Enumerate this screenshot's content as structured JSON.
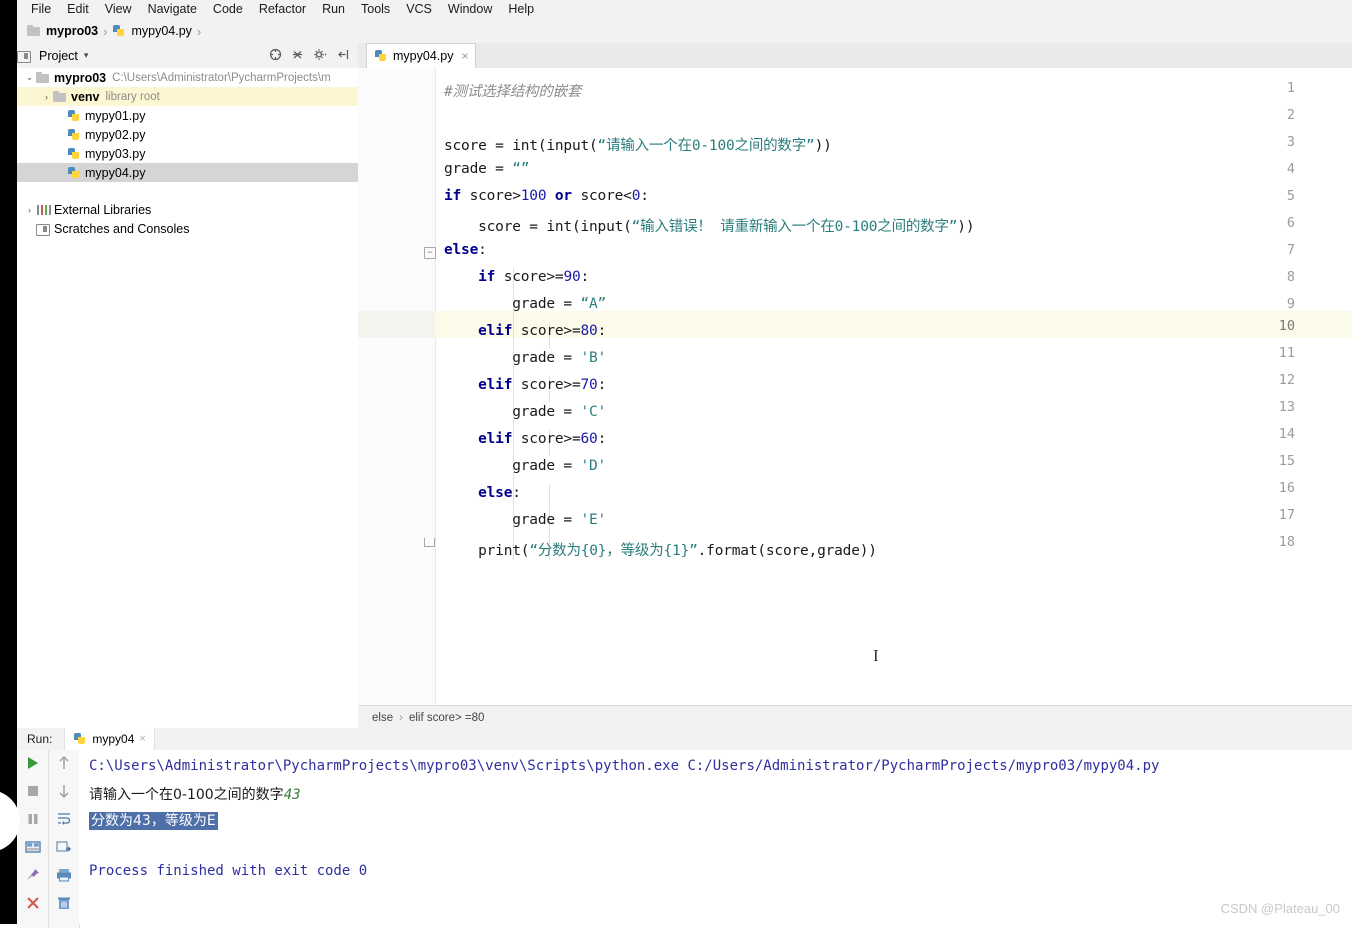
{
  "menu": {
    "items": [
      "File",
      "Edit",
      "View",
      "Navigate",
      "Code",
      "Refactor",
      "Run",
      "Tools",
      "VCS",
      "Window",
      "Help"
    ]
  },
  "navbar": {
    "project_name": "mypro03",
    "file_name": "mypy04.py",
    "separator": "›"
  },
  "project_panel": {
    "title": "Project",
    "caret": "▾",
    "tools": [
      "target-icon",
      "collapse-all-icon",
      "settings-icon",
      "hide-icon"
    ],
    "tree": [
      {
        "label": "mypro03",
        "path": "C:\\Users\\Administrator\\PycharmProjects\\m",
        "icon": "folder-icon",
        "arrow": "⌄",
        "depth": 0,
        "bold": true,
        "state": "normal"
      },
      {
        "label": "venv",
        "path": "library root",
        "icon": "folder-icon",
        "arrow": "›",
        "depth": 1,
        "bold": true,
        "state": "yellow"
      },
      {
        "label": "mypy01.py",
        "path": "",
        "icon": "python-file-icon",
        "arrow": "",
        "depth": 2,
        "bold": false,
        "state": "normal"
      },
      {
        "label": "mypy02.py",
        "path": "",
        "icon": "python-file-icon",
        "arrow": "",
        "depth": 2,
        "bold": false,
        "state": "normal"
      },
      {
        "label": "mypy03.py",
        "path": "",
        "icon": "python-file-icon",
        "arrow": "",
        "depth": 2,
        "bold": false,
        "state": "normal"
      },
      {
        "label": "mypy04.py",
        "path": "",
        "icon": "python-file-icon",
        "arrow": "",
        "depth": 2,
        "bold": false,
        "state": "gray"
      },
      {
        "label": "External Libraries",
        "path": "",
        "icon": "libraries-icon",
        "arrow": "›",
        "depth": 0,
        "bold": false,
        "state": "normal"
      },
      {
        "label": "Scratches and Consoles",
        "path": "",
        "icon": "scratches-icon",
        "arrow": "",
        "depth": 0,
        "bold": false,
        "state": "normal"
      }
    ]
  },
  "editor": {
    "tab_label": "mypy04.py",
    "tab_close": "×",
    "current_line": 10,
    "line_count": 18,
    "lines": [
      {
        "n": 1,
        "text": "#测试选择结构的嵌套"
      },
      {
        "n": 2,
        "text": ""
      },
      {
        "n": 3,
        "text": "score = int(input(“请输入一个在0-100之间的数字”))"
      },
      {
        "n": 4,
        "text": "grade = “”"
      },
      {
        "n": 5,
        "text": "if score>100 or score<0:"
      },
      {
        "n": 6,
        "text": "    score = int(input(“输入错误！ 请重新输入一个在0-100之间的数字”))"
      },
      {
        "n": 7,
        "text": "else:"
      },
      {
        "n": 8,
        "text": "    if score>=90:"
      },
      {
        "n": 9,
        "text": "        grade = “A”"
      },
      {
        "n": 10,
        "text": "    elif score>=80:"
      },
      {
        "n": 11,
        "text": "        grade = 'B'"
      },
      {
        "n": 12,
        "text": "    elif score>=70:"
      },
      {
        "n": 13,
        "text": "        grade = 'C'"
      },
      {
        "n": 14,
        "text": "    elif score>=60:"
      },
      {
        "n": 15,
        "text": "        grade = 'D'"
      },
      {
        "n": 16,
        "text": "    else:"
      },
      {
        "n": 17,
        "text": "        grade = 'E'"
      },
      {
        "n": 18,
        "text": "    print(“分数为{0}，等级为{1}”.format(score,grade))"
      }
    ],
    "breadcrumb": {
      "first": "else",
      "sep": "›",
      "second": "elif score> =80"
    }
  },
  "run_panel": {
    "label": "Run:",
    "tab_name": "mypy04",
    "tab_close": "×",
    "toolbar_left": [
      "run-icon",
      "stop-icon",
      "pause-icon",
      "layout-icon",
      "pin-icon",
      "close-icon"
    ],
    "toolbar_right": [
      "scroll-up-icon",
      "scroll-down-icon",
      "soft-wrap-icon",
      "export-icon",
      "print-icon",
      "trash-icon"
    ],
    "console": {
      "command": "C:\\Users\\Administrator\\PycharmProjects\\mypro03\\venv\\Scripts\\python.exe C:/Users/Administrator/PycharmProjects/mypro03/mypy04.py",
      "prompt": "请输入一个在0-100之间的数字",
      "user_input": "43",
      "result": "分数为43，等级为E",
      "exit_message": "Process finished with exit code 0"
    }
  },
  "watermark": "CSDN @Plateau_00",
  "colors": {
    "keyword": "#00008b",
    "string": "#2a7d7d",
    "number": "#1a1aa8",
    "comment": "#8c8c8c",
    "current_line": "#fcfae8",
    "selection": "#4e6fa8",
    "console_command": "#2f2f9f"
  }
}
